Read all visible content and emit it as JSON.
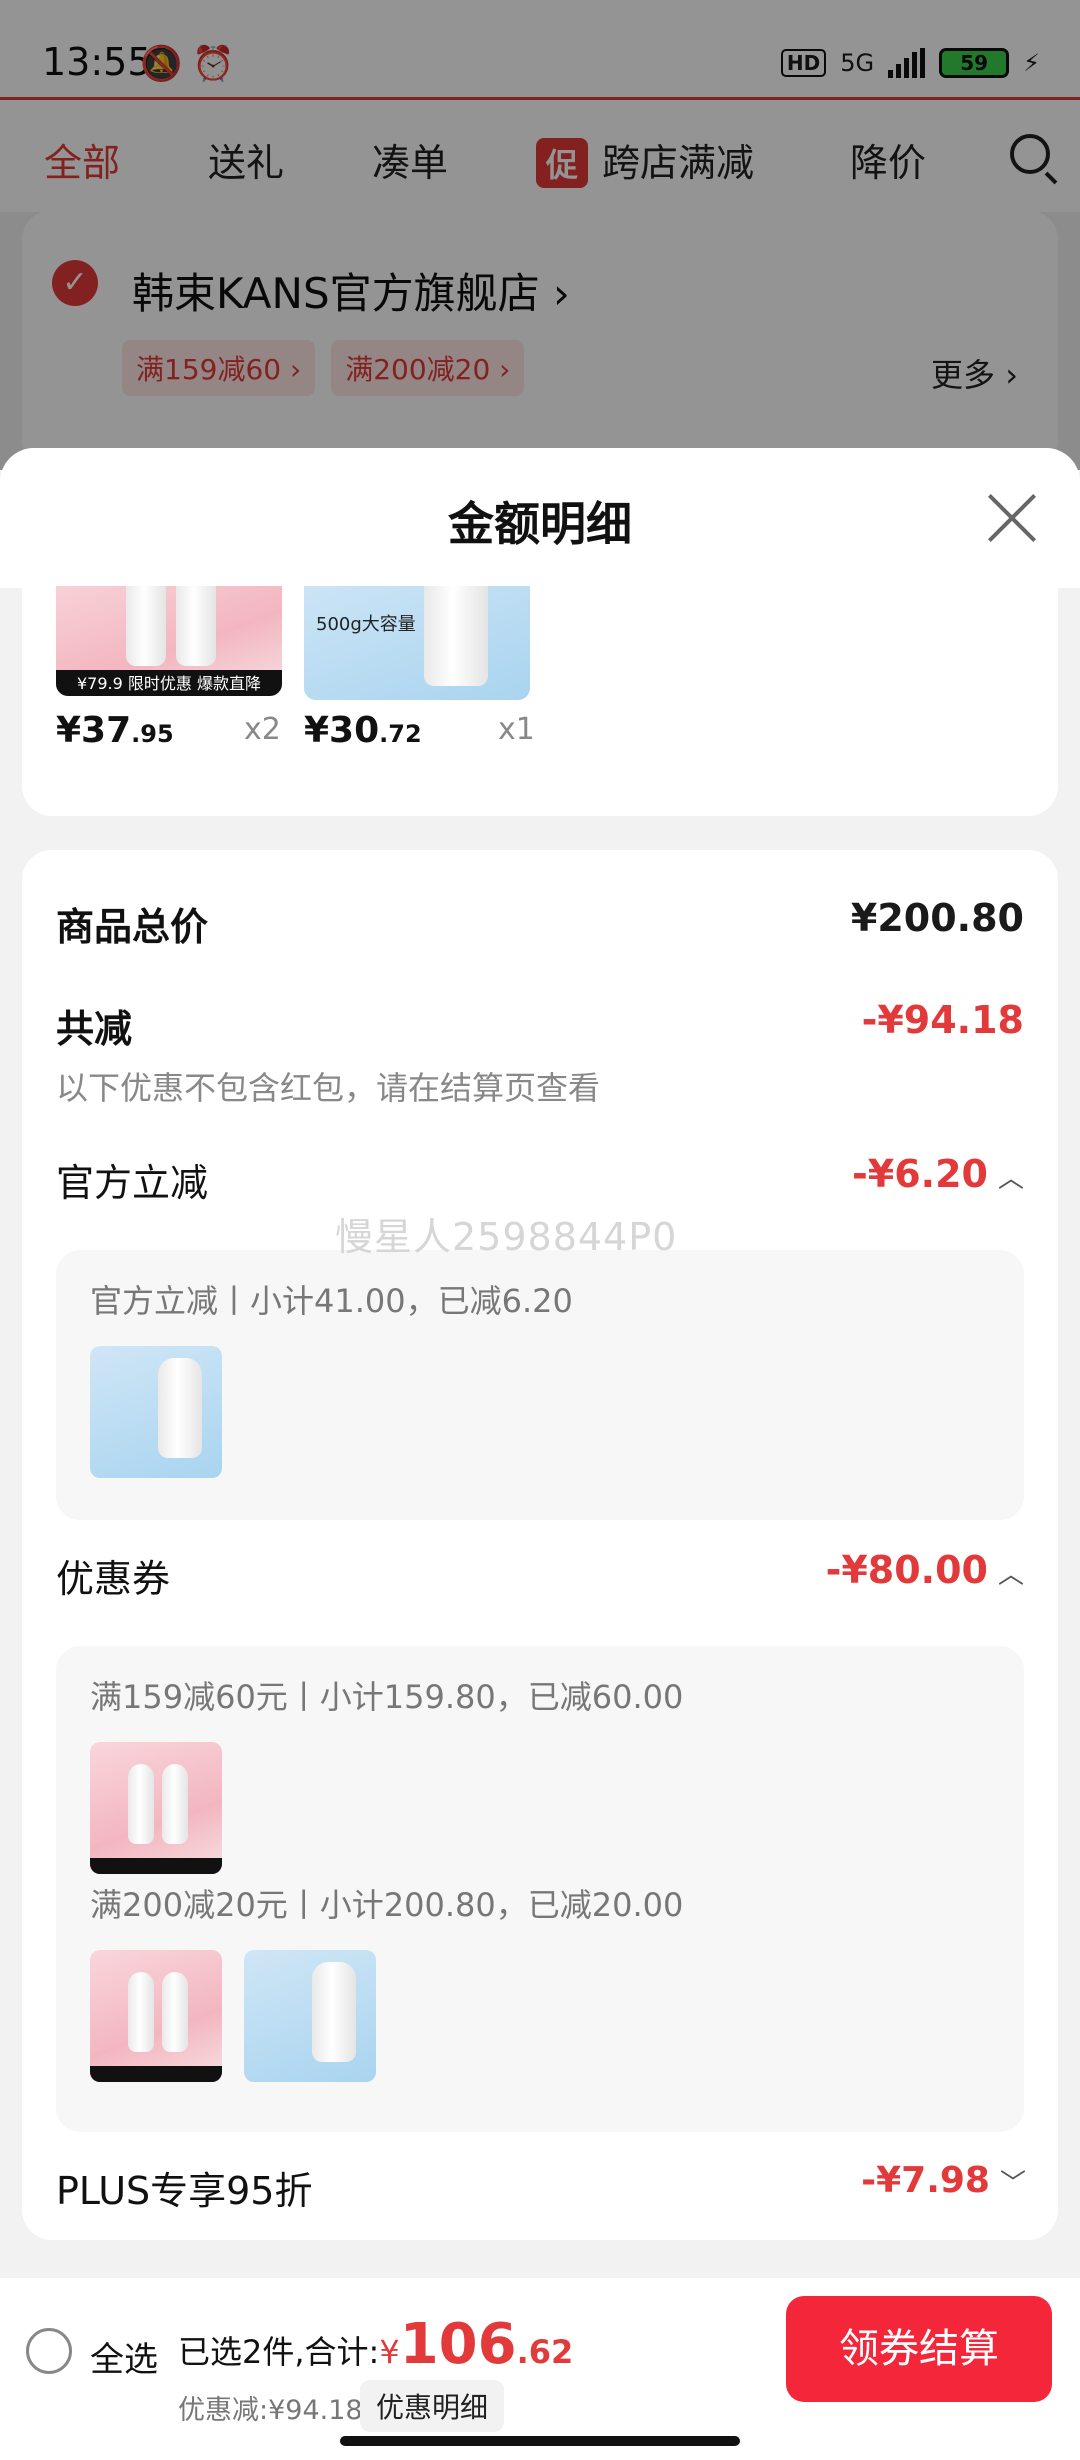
{
  "status_bar": {
    "time": "13:55",
    "hd": "HD",
    "network": "5G",
    "battery": "59"
  },
  "tabs": [
    {
      "label": "全部",
      "active": true
    },
    {
      "label": "送礼"
    },
    {
      "label": "凑单"
    },
    {
      "label": "跨店满减",
      "badge": "促"
    },
    {
      "label": "降价"
    }
  ],
  "store": {
    "name": "韩束KANS官方旗舰店",
    "promos": [
      "满159减60",
      "满200减20"
    ],
    "more": "更多"
  },
  "sheet": {
    "title": "金额明细"
  },
  "products": [
    {
      "price_int": "¥37",
      "price_dec": ".95",
      "qty": "x2",
      "tag_price": "¥79.9",
      "tag": "限时优惠 爆款直降"
    },
    {
      "price_int": "¥30",
      "price_dec": ".72",
      "qty": "x1",
      "tag": "500g大容量"
    }
  ],
  "detail": {
    "total_label": "商品总价",
    "total_value": "¥200.80",
    "reduce_label": "共减",
    "reduce_value": "-¥94.18",
    "reduce_note": "以下优惠不包含红包，请在结算页查看",
    "watermark": "慢星人2598844P0",
    "official": {
      "label": "官方立减",
      "value": "-¥6.20",
      "box_text": "官方立减丨小计41.00，已减6.20"
    },
    "coupon": {
      "label": "优惠券",
      "value": "-¥80.00",
      "line1": "满159减60元丨小计159.80，已减60.00",
      "line2": "满200减20元丨小计200.80，已减20.00"
    },
    "plus": {
      "label": "PLUS专享95折",
      "value": "-¥7.98"
    }
  },
  "bottom_bar": {
    "select_all": "全选",
    "summary_prefix": "已选2件,合计:",
    "currency": "¥",
    "total_int": "106",
    "total_dec": ".62",
    "discount": "优惠减:¥94.18",
    "detail_chip": "优惠明细",
    "checkout": "领券结算"
  },
  "colors": {
    "accent": "#e23a3a",
    "checkout": "#f4273a"
  }
}
